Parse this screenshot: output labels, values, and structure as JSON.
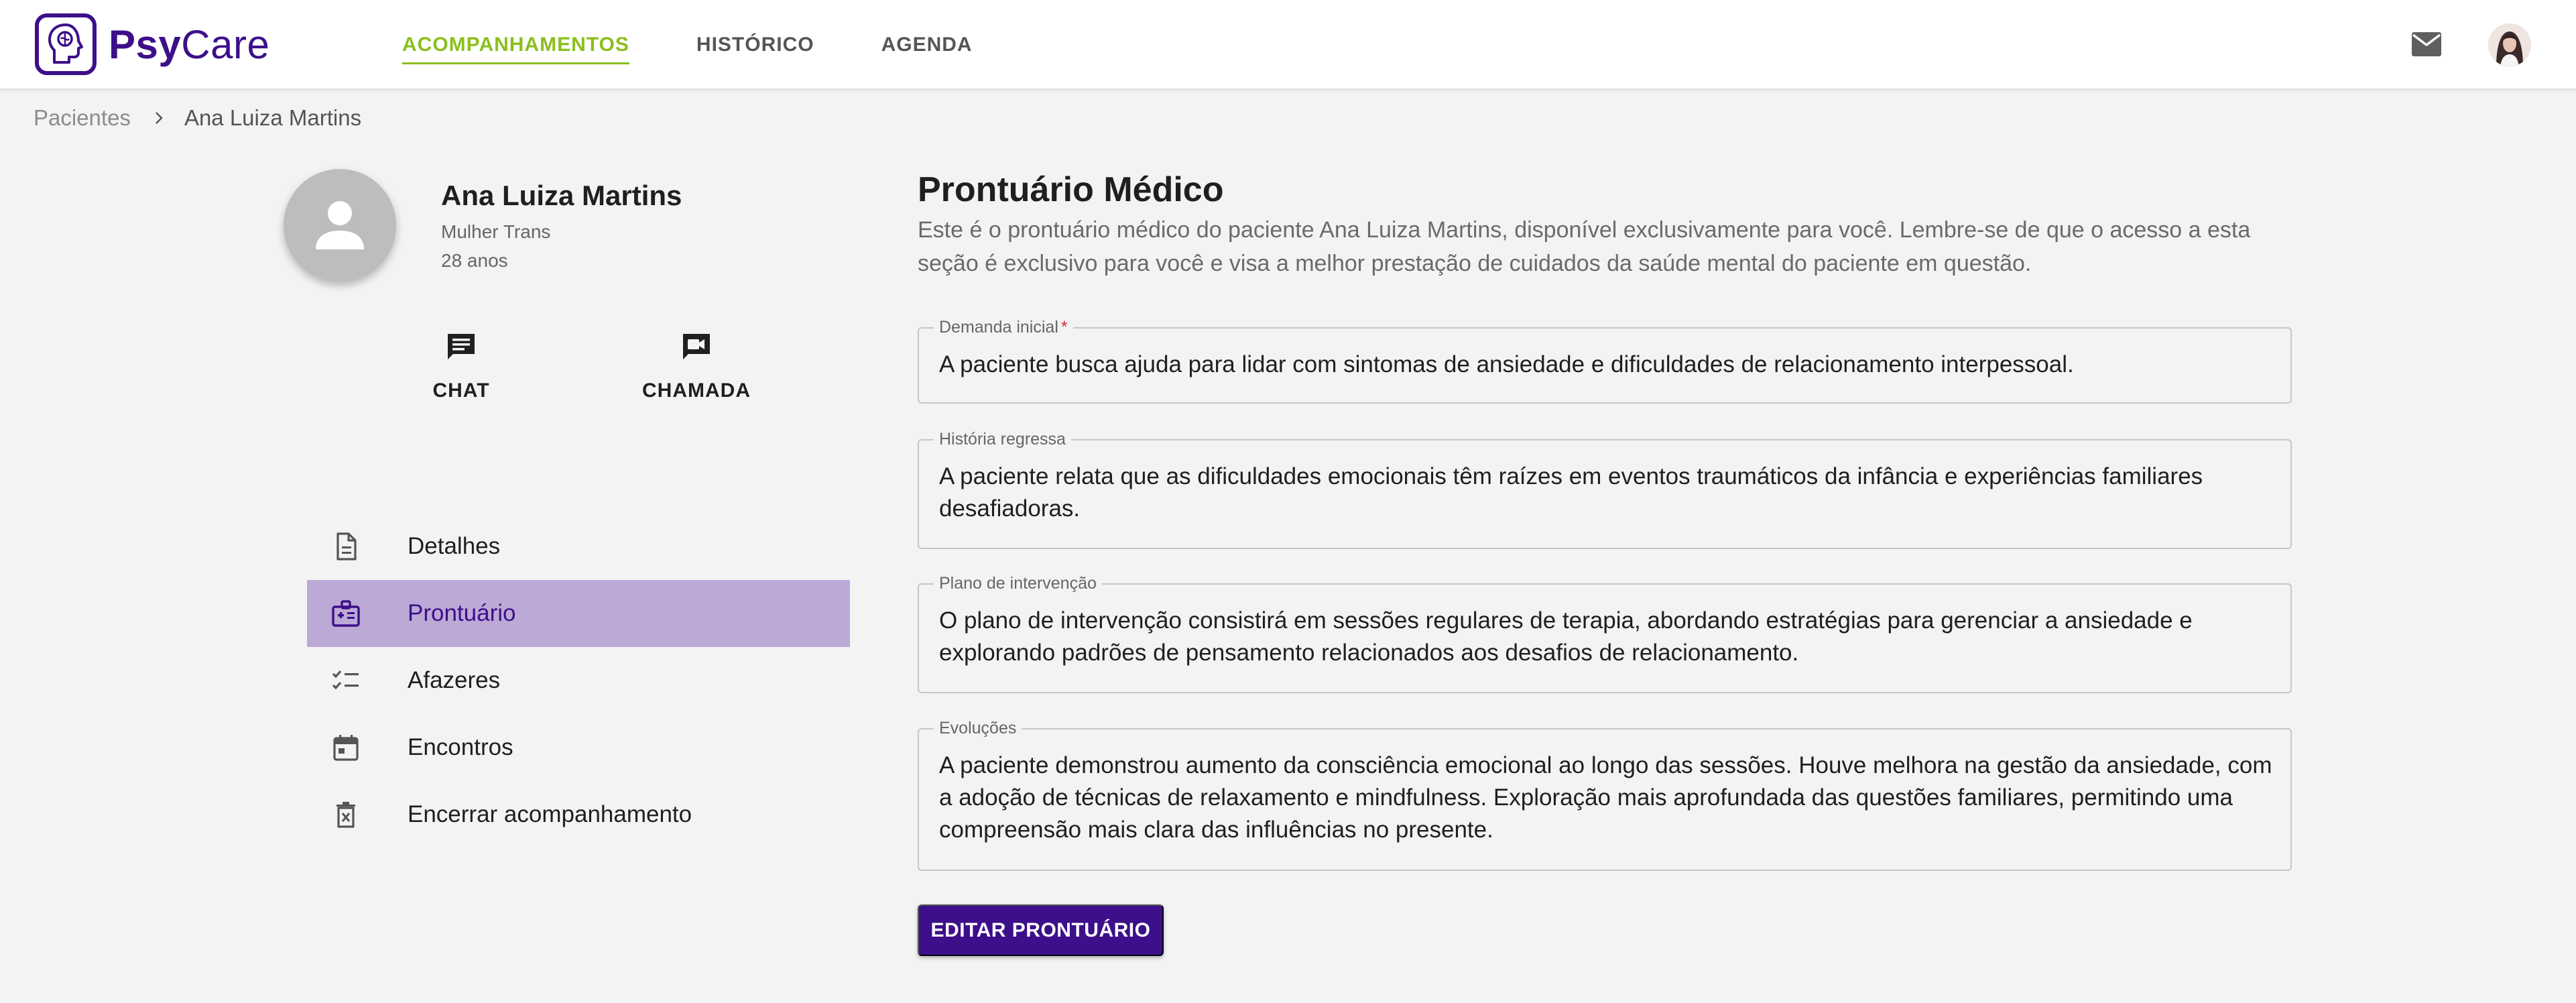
{
  "app": {
    "logo_bold": "Psy",
    "logo_regular": "Care"
  },
  "nav": {
    "items": [
      "ACOMPANHAMENTOS",
      "HISTÓRICO",
      "AGENDA"
    ],
    "active": "ACOMPANHAMENTOS"
  },
  "topbar_icons": [
    "mail-icon",
    "user-avatar"
  ],
  "breadcrumb": {
    "root": "Pacientes",
    "current": "Ana Luiza Martins"
  },
  "patient": {
    "name": "Ana Luiza Martins",
    "gender": "Mulher Trans",
    "age": "28 anos"
  },
  "actions": {
    "chat": "CHAT",
    "call": "CHAMADA"
  },
  "menu": {
    "items": [
      "Detalhes",
      "Prontuário",
      "Afazeres",
      "Encontros",
      "Encerrar acompanhamento"
    ],
    "active": "Prontuário"
  },
  "record": {
    "title": "Prontuário Médico",
    "description": "Este é o prontuário médico do paciente Ana Luiza Martins, disponível exclusivamente para você. Lembre-se de que o acesso a esta seção é exclusivo para você e visa a melhor prestação de cuidados da saúde mental do paciente em questão.",
    "fields": [
      {
        "label": "Demanda inicial",
        "required": "*",
        "value": "A paciente busca ajuda para lidar com sintomas de ansiedade e dificuldades de relacionamento interpessoal."
      },
      {
        "label": "História regressa",
        "value": "A paciente relata que as dificuldades emocionais têm raízes em eventos traumáticos da infância e experiências familiares desafiadoras."
      },
      {
        "label": "Plano de intervenção",
        "value": "O plano de intervenção consistirá em sessões regulares de terapia, abordando estratégias para gerenciar a ansiedade e explorando padrões de pensamento relacionados aos desafios de relacionamento."
      },
      {
        "label": "Evoluções",
        "value": "A paciente demonstrou aumento da consciência emocional ao longo das sessões. Houve melhora na gestão da ansiedade, com a adoção de técnicas de relaxamento e mindfulness. Exploração mais aprofundada das questões familiares, permitindo uma compreensão mais clara das influências no presente."
      }
    ],
    "edit_button": "EDITAR PRONTUÁRIO"
  },
  "colors": {
    "brand": "#3d0f8a",
    "nav_active": "#8bbf1c",
    "menu_active_bg": "#bca9d6",
    "page_bg": "#f3f3f3",
    "required": "#d32f2f"
  }
}
